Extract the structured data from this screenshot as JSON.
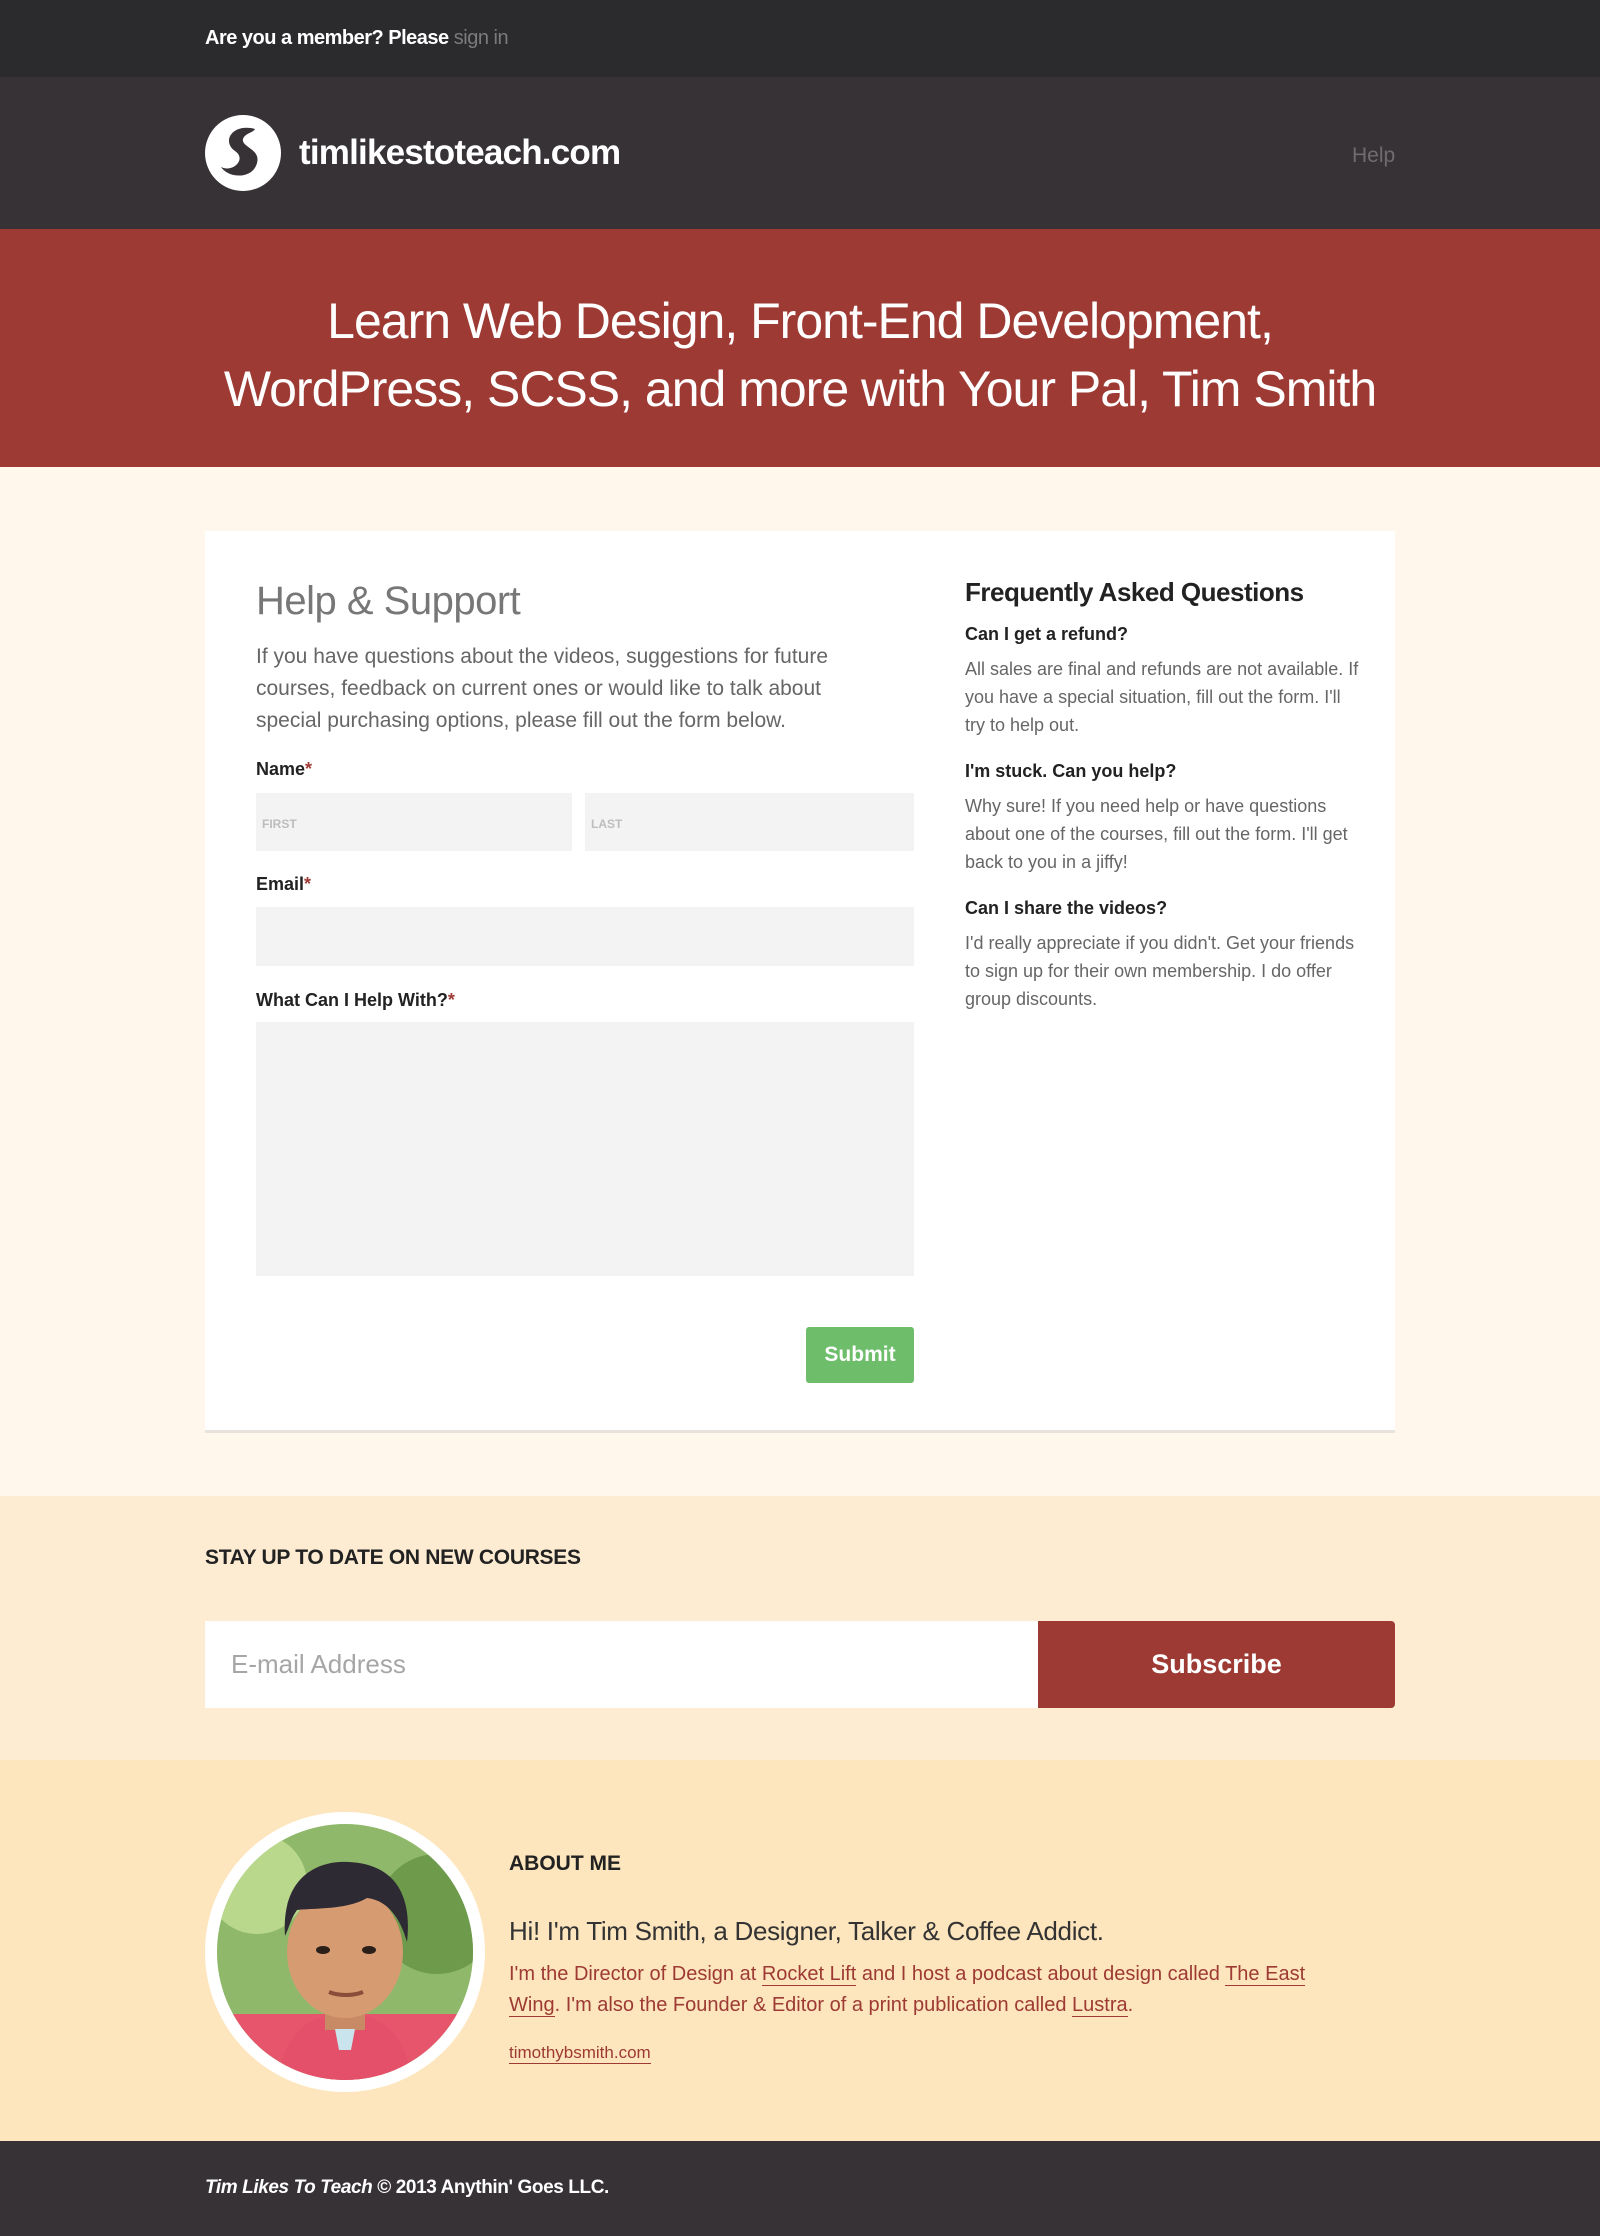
{
  "topbar": {
    "prompt": "Are you a member? Please",
    "signin_label": "sign in"
  },
  "header": {
    "site_name": "timlikestoteach.com",
    "nav_help": "Help"
  },
  "hero": {
    "line1": "Learn Web Design, Front-End Development,",
    "line2": "WordPress, SCSS, and more with Your Pal, Tim Smith"
  },
  "form": {
    "title": "Help & Support",
    "intro": "If you have questions about the videos, suggestions for future courses, feedback on current ones or would like to talk about special purchasing options, please fill out the form below.",
    "name_label": "Name",
    "first_placeholder": "FIRST",
    "last_placeholder": "LAST",
    "email_label": "Email",
    "help_label": "What Can I Help With?",
    "required_mark": "*",
    "submit_label": "Submit"
  },
  "faq": {
    "title": "Frequently Asked Questions",
    "items": [
      {
        "q": "Can I get a refund?",
        "a": "All sales are final and refunds are not available. If you have a special situation, fill out the form. I'll try to help out."
      },
      {
        "q": "I'm stuck. Can you help?",
        "a": "Why sure! If you need help or have questions about one of the courses, fill out the form. I'll get back to you in a jiffy!"
      },
      {
        "q": "Can I share the videos?",
        "a": "I'd really appreciate if you didn't. Get your friends to sign up for their own membership. I do offer group discounts."
      }
    ]
  },
  "signup": {
    "title": "STAY UP TO DATE ON NEW COURSES",
    "email_placeholder": "E-mail Address",
    "subscribe_label": "Subscribe"
  },
  "about": {
    "title": "ABOUT ME",
    "tagline": "Hi! I'm Tim Smith, a Designer, Talker & Coffee Addict.",
    "bio_1": "I'm the Director of Design at ",
    "link_rocket": "Rocket Lift",
    "bio_2": " and I host a podcast about design called ",
    "link_eastwing": "The East Wing",
    "bio_3": ". I'm also the Founder & Editor of a print publication called ",
    "link_lustra": "Lustra",
    "bio_4": ".",
    "website": "timothybsmith.com"
  },
  "footer": {
    "brand": "Tim Likes To Teach",
    "copyright": " © 2013 Anythin' Goes LLC."
  },
  "colors": {
    "accent": "#9d3a34",
    "dark": "#363236",
    "submit_green": "#6dbd6a",
    "cream": "#fff6ec",
    "peach": "#fde5bd"
  }
}
